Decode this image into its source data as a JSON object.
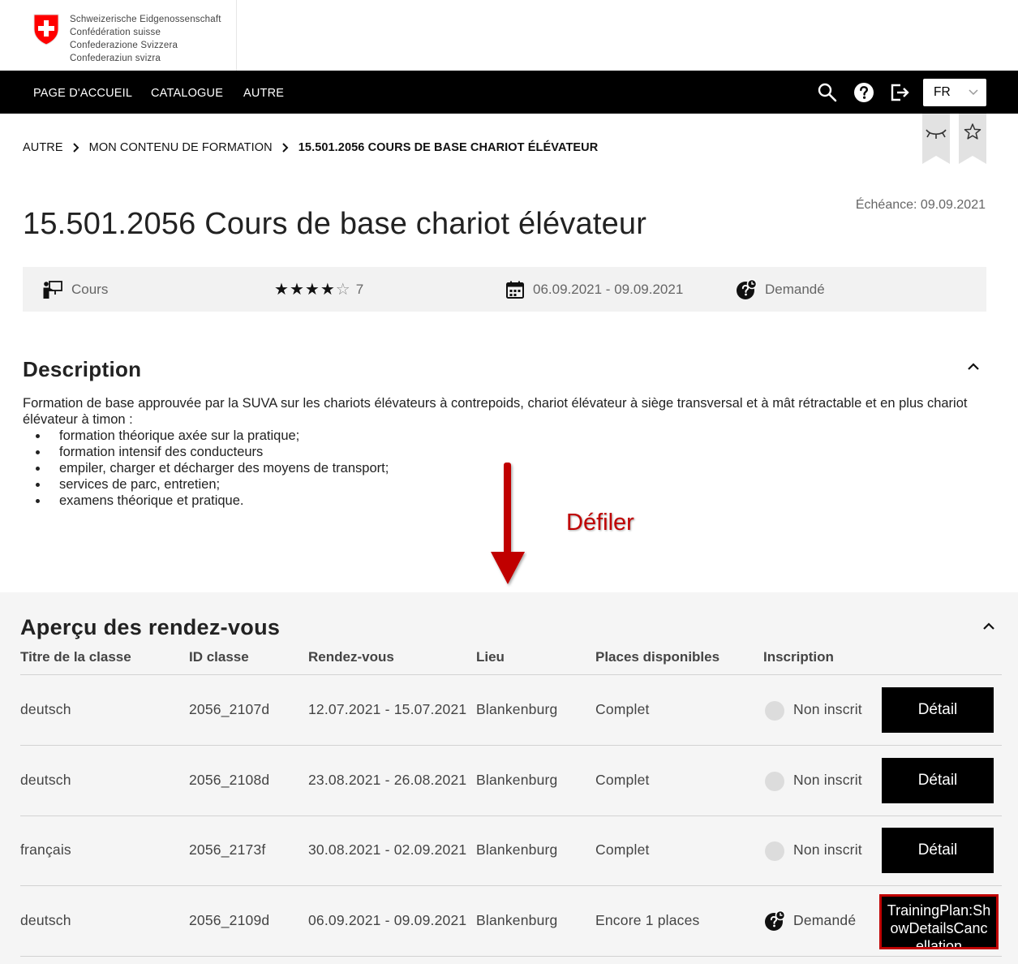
{
  "brand": {
    "lines": [
      "Schweizerische Eidgenossenschaft",
      "Confédération suisse",
      "Confederazione Svizzera",
      "Confederaziun svizra"
    ]
  },
  "nav": {
    "items": [
      "PAGE D'ACCUEIL",
      "CATALOGUE",
      "AUTRE"
    ],
    "language": "FR"
  },
  "breadcrumb": [
    "AUTRE",
    "MON CONTENU DE FORMATION",
    "15.501.2056 COURS DE BASE CHARIOT ÉLÉVATEUR"
  ],
  "due": "Échéance: 09.09.2021",
  "title": "15.501.2056 Cours de base chariot élévateur",
  "meta": {
    "type": "Cours",
    "rating_stars": 4,
    "rating_max": 5,
    "rating_count": "7",
    "dates": "06.09.2021 - 09.09.2021",
    "status": "Demandé"
  },
  "description": {
    "heading": "Description",
    "intro": "Formation de base approuvée par la SUVA sur les chariots élévateurs à contrepoids, chariot élévateur à siège transversal et à mât rétractable et en plus chariot élévateur à timon :",
    "items": [
      "formation théorique axée sur la pratique;",
      "formation intensif des conducteurs",
      "empiler, charger et décharger des moyens de transport;",
      "services de parc, entretien;",
      "examens théorique et pratique."
    ]
  },
  "annotation": {
    "scroll_label": "Défiler",
    "color": "#c00000"
  },
  "appointments": {
    "heading": "Aperçu des rendez-vous",
    "columns": [
      "Titre de la classe",
      "ID classe",
      "Rendez-vous",
      "Lieu",
      "Places disponibles",
      "Inscription"
    ],
    "rows": [
      {
        "title": "deutsch",
        "id": "2056_2107d",
        "dates": "12.07.2021 - 15.07.2021",
        "place": "Blankenburg",
        "seats": "Complet",
        "status": "Non inscrit",
        "action": "Détail"
      },
      {
        "title": "deutsch",
        "id": "2056_2108d",
        "dates": "23.08.2021 - 26.08.2021",
        "place": "Blankenburg",
        "seats": "Complet",
        "status": "Non inscrit",
        "action": "Détail"
      },
      {
        "title": "français",
        "id": "2056_2173f",
        "dates": "30.08.2021 - 02.09.2021",
        "place": "Blankenburg",
        "seats": "Complet",
        "status": "Non inscrit",
        "action": "Détail"
      },
      {
        "title": "deutsch",
        "id": "2056_2109d",
        "dates": "06.09.2021 - 09.09.2021",
        "place": "Blankenburg",
        "seats": "Encore 1 places",
        "status": "Demandé",
        "action": "TrainingPlan:ShowDetailsCancellation"
      }
    ]
  }
}
